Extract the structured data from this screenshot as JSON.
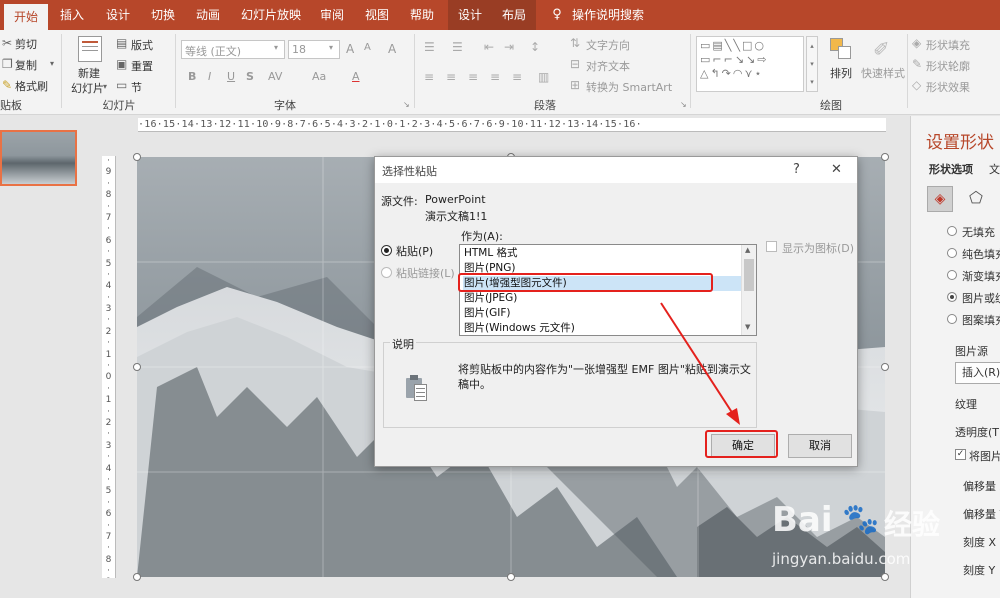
{
  "tabs": [
    {
      "label": "开始"
    },
    {
      "label": "插入"
    },
    {
      "label": "设计"
    },
    {
      "label": "切换"
    },
    {
      "label": "动画"
    },
    {
      "label": "幻灯片放映"
    },
    {
      "label": "审阅"
    },
    {
      "label": "视图"
    },
    {
      "label": "帮助"
    },
    {
      "label": "设计"
    },
    {
      "label": "布局"
    },
    {
      "label": "操作说明搜索"
    }
  ],
  "ribbon": {
    "clipboard": {
      "cut": "剪切",
      "copy": "复制",
      "format_painter": "格式刷",
      "group": "贴板"
    },
    "slides": {
      "new_slide_1": "新建",
      "new_slide_2": "幻灯片",
      "layout": "版式",
      "reset": "重置",
      "section": "节",
      "group": "幻灯片"
    },
    "font": {
      "name": "等线 (正文)",
      "size": "18",
      "group": "字体",
      "bold": "B",
      "italic": "I",
      "underline": "U",
      "strike": "S",
      "spacing": "AV",
      "case": "Aa",
      "grow": "A",
      "shrink": "A",
      "clear": "A",
      "color": "A"
    },
    "paragraph": {
      "group": "段落",
      "text_direction": "文字方向",
      "align_text": "对齐文本",
      "smartart": "转换为 SmartArt"
    },
    "drawing": {
      "group": "绘图",
      "arrange": "排列",
      "quick_styles": "快速样式",
      "fill": "形状填充",
      "outline": "形状轮廓",
      "effects": "形状效果"
    }
  },
  "hruler": "·16·15·14·13·12·11·10·9·8·7·6·5·4·3·2·1·0·1·2·3·4·5·6·7·6·9·10·11·12·13·14·15·16·",
  "vruler": [
    "·",
    "9",
    "·",
    "8",
    "·",
    "7",
    "·",
    "6",
    "·",
    "5",
    "·",
    "4",
    "·",
    "3",
    "·",
    "2",
    "·",
    "1",
    "·",
    "0",
    "·",
    "1",
    "·",
    "2",
    "·",
    "3",
    "·",
    "4",
    "·",
    "5",
    "·",
    "6",
    "·",
    "7",
    "·",
    "8",
    "·",
    "9"
  ],
  "right_pane": {
    "title": "设置形状",
    "tab_shape": "形状选项",
    "tab_text": "文",
    "options": [
      "无填充",
      "纯色填充",
      "渐变填充",
      "图片或纹",
      "图案填充"
    ],
    "picture_source": "图片源",
    "insert_btn": "插入(R)...",
    "texture": "纹理",
    "transparency": "透明度(T)",
    "tile_check": "将图片",
    "offset_x": "偏移量 X",
    "offset_y": "偏移量 Y",
    "scale_x": "刻度 X",
    "scale_y": "刻度 Y"
  },
  "dialog": {
    "title": "选择性粘贴",
    "help": "?",
    "close": "✕",
    "source_label": "源文件:",
    "source_app": "PowerPoint",
    "source_doc": "演示文稿1!1",
    "as_label": "作为(A):",
    "paste_radio": "粘贴(P)",
    "paste_link_radio": "粘贴链接(L)",
    "show_icon": "显示为图标(D)",
    "formats": [
      "HTML 格式",
      "图片(PNG)",
      "图片(增强型图元文件)",
      "图片(JPEG)",
      "图片(GIF)",
      "图片(Windows 元文件)"
    ],
    "selected_index": 2,
    "result_label": "说明",
    "result_text_1": "将剪贴板中的内容作为\"一张增强型 EMF 图片\"粘贴到演示文",
    "result_text_2": "稿中。",
    "ok": "确定",
    "cancel": "取消"
  },
  "watermark": {
    "brand": "Bai",
    "brand2": "经验",
    "url": "jingyan.baidu.com"
  },
  "colors": {
    "accent": "#b7472a",
    "highlight": "#e4211d",
    "selection": "#cce4f7"
  }
}
